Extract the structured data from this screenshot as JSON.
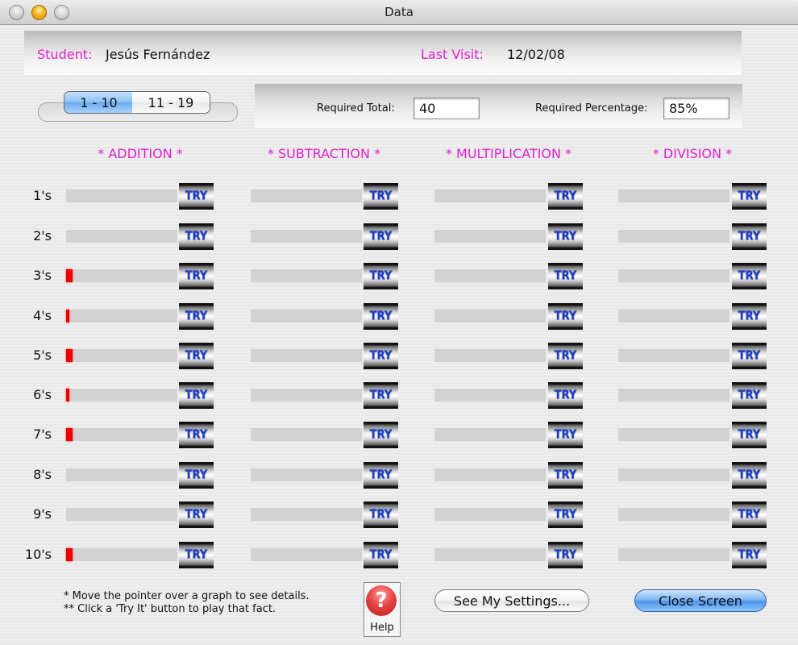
{
  "window": {
    "title": "Data"
  },
  "header": {
    "student_label": "Student:",
    "student_name": "Jesús Fernández",
    "last_visit_label": "Last Visit:",
    "last_visit_date": "12/02/08"
  },
  "range_selector": {
    "options": [
      "1 - 10",
      "11 - 19"
    ],
    "selected": "1 - 10"
  },
  "requirements": {
    "total_label": "Required Total:",
    "total_value": "40",
    "percentage_label": "Required Percentage:",
    "percentage_value": "85%"
  },
  "operations": [
    {
      "key": "addition",
      "label": "* ADDITION *"
    },
    {
      "key": "subtraction",
      "label": "* SUBTRACTION *"
    },
    {
      "key": "multiplication",
      "label": "* MULTIPLICATION *"
    },
    {
      "key": "division",
      "label": "* DIVISION *"
    }
  ],
  "row_labels": [
    "1's",
    "2's",
    "3's",
    "4's",
    "5's",
    "6's",
    "7's",
    "8's",
    "9's",
    "10's"
  ],
  "try_label": "TRY",
  "progress": {
    "addition": [
      0,
      0,
      0.06,
      0.03,
      0.06,
      0.03,
      0.06,
      0,
      0,
      0.06
    ],
    "subtraction": [
      0,
      0,
      0,
      0,
      0,
      0,
      0,
      0,
      0,
      0
    ],
    "multiplication": [
      0,
      0,
      0,
      0,
      0,
      0,
      0,
      0,
      0,
      0
    ],
    "division": [
      0,
      0,
      0,
      0,
      0,
      0,
      0,
      0,
      0,
      0
    ]
  },
  "colors": {
    "accent_label": "#e020d0",
    "progress_fill": "#ee0000",
    "bar_background": "#d2d2d2",
    "try_text": "#1e3fc4"
  },
  "footer": {
    "note1": "* Move the pointer over a graph to see details.",
    "note2": "** Click a 'Try It' button to play that fact.",
    "help_label": "Help",
    "help_icon": "question-mark-icon",
    "settings_button": "See My Settings...",
    "close_button": "Close Screen"
  }
}
